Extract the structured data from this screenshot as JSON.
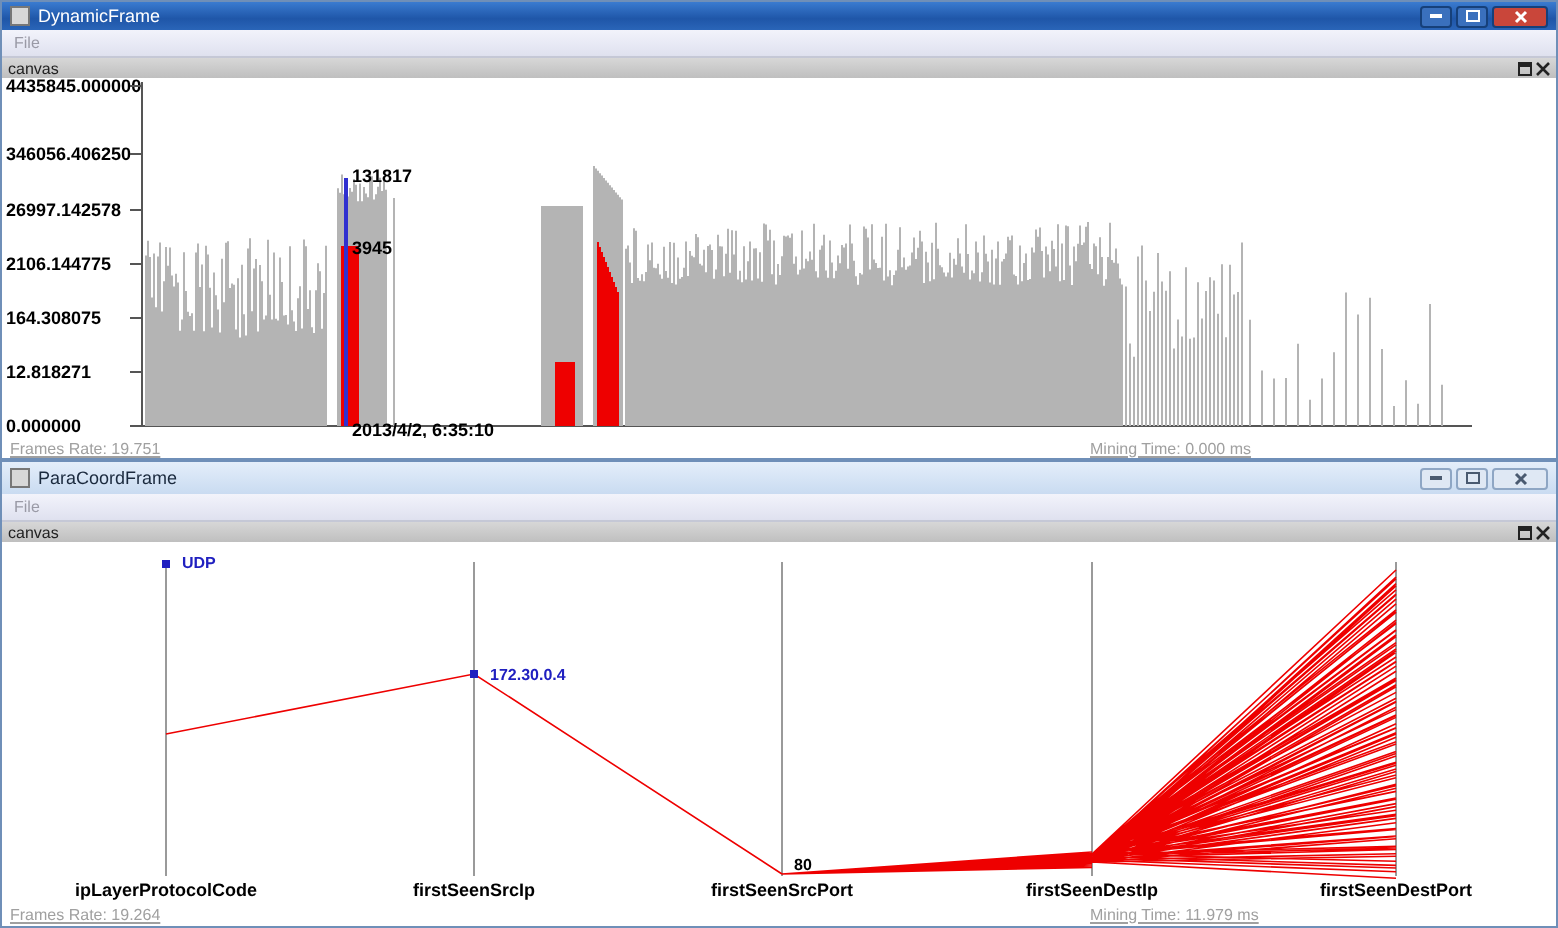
{
  "windows": [
    {
      "title": "DynamicFrame",
      "active": true,
      "menu": [
        "File"
      ],
      "panel_title": "canvas",
      "kind": "histogram",
      "y_ticks": [
        "4435845.000000",
        "346056.406250",
        "26997.142578",
        "2106.144775",
        "164.308075",
        "12.818271",
        "0.000000"
      ],
      "annotations": [
        {
          "text": "131817"
        },
        {
          "text": "3945"
        },
        {
          "text": "2013/4/2, 6:35:10"
        }
      ],
      "status": {
        "frames_rate": "Frames Rate: 19.751",
        "mining_time": "Mining Time: 0.000 ms"
      }
    },
    {
      "title": "ParaCoordFrame",
      "active": false,
      "menu": [
        "File"
      ],
      "panel_title": "canvas",
      "kind": "parallel",
      "axes": [
        "ipLayerProtocolCode",
        "firstSeenSrcIp",
        "firstSeenSrcPort",
        "firstSeenDestIp",
        "firstSeenDestPort"
      ],
      "annotations": [
        {
          "text": "UDP"
        },
        {
          "text": "172.30.0.4"
        },
        {
          "text": "80"
        }
      ],
      "status": {
        "frames_rate": "Frames Rate: 19.264",
        "mining_time": "Mining Time: 11.979 ms"
      }
    }
  ]
}
